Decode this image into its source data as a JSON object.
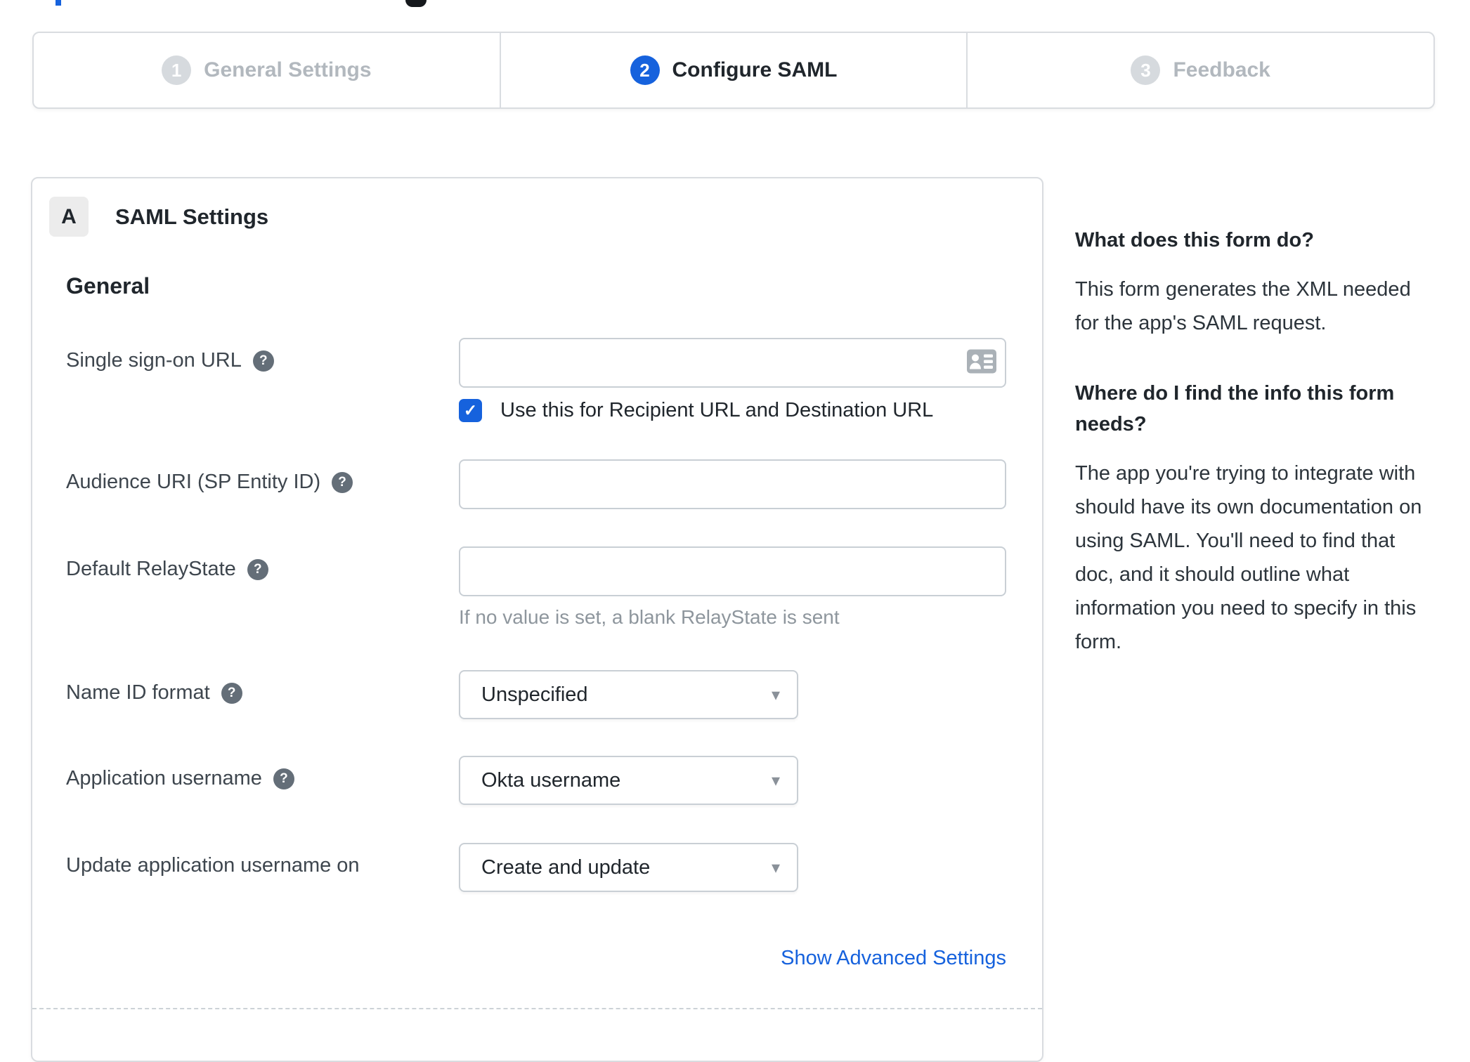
{
  "colors": {
    "accent_blue": "#1662dd",
    "inactive_gray": "#d6dade",
    "panel_border": "#d9dce0",
    "input_border": "#c9cfd5",
    "hint_gray": "#8e969d"
  },
  "icons": {
    "help_glyph": "?",
    "checkmark_glyph": "✓",
    "chevron_down_glyph": "▾",
    "contact_card": "contact-card"
  },
  "stepper": {
    "steps": [
      {
        "number": "1",
        "label": "General Settings",
        "state": "inactive"
      },
      {
        "number": "2",
        "label": "Configure SAML",
        "state": "active"
      },
      {
        "number": "3",
        "label": "Feedback",
        "state": "inactive"
      }
    ]
  },
  "panel": {
    "badge": "A",
    "title": "SAML Settings",
    "section_heading": "General",
    "fields": [
      {
        "id": "sso-url",
        "label": "Single sign-on URL",
        "has_help": true,
        "type": "text",
        "value": "",
        "checkbox": {
          "checked": true,
          "label": "Use this for Recipient URL and Destination URL"
        }
      },
      {
        "id": "audience-uri",
        "label": "Audience URI (SP Entity ID)",
        "has_help": true,
        "type": "text",
        "value": ""
      },
      {
        "id": "default-relaystate",
        "label": "Default RelayState",
        "has_help": true,
        "type": "text",
        "value": "",
        "hint": "If no value is set, a blank RelayState is sent"
      },
      {
        "id": "name-id-format",
        "label": "Name ID format",
        "has_help": true,
        "type": "select",
        "value": "Unspecified"
      },
      {
        "id": "application-username",
        "label": "Application username",
        "has_help": true,
        "type": "select",
        "value": "Okta username"
      },
      {
        "id": "update-application-username-on",
        "label": "Update application username on",
        "has_help": false,
        "type": "select",
        "value": "Create and update"
      }
    ],
    "advanced_link": "Show Advanced Settings"
  },
  "sidebar": {
    "sections": [
      {
        "heading": "What does this form do?",
        "body": "This form generates the XML needed for the app's SAML request."
      },
      {
        "heading": "Where do I find the info this form needs?",
        "body": "The app you're trying to integrate with should have its own documentation on using SAML. You'll need to find that doc, and it should outline what information you need to specify in this form."
      }
    ]
  }
}
